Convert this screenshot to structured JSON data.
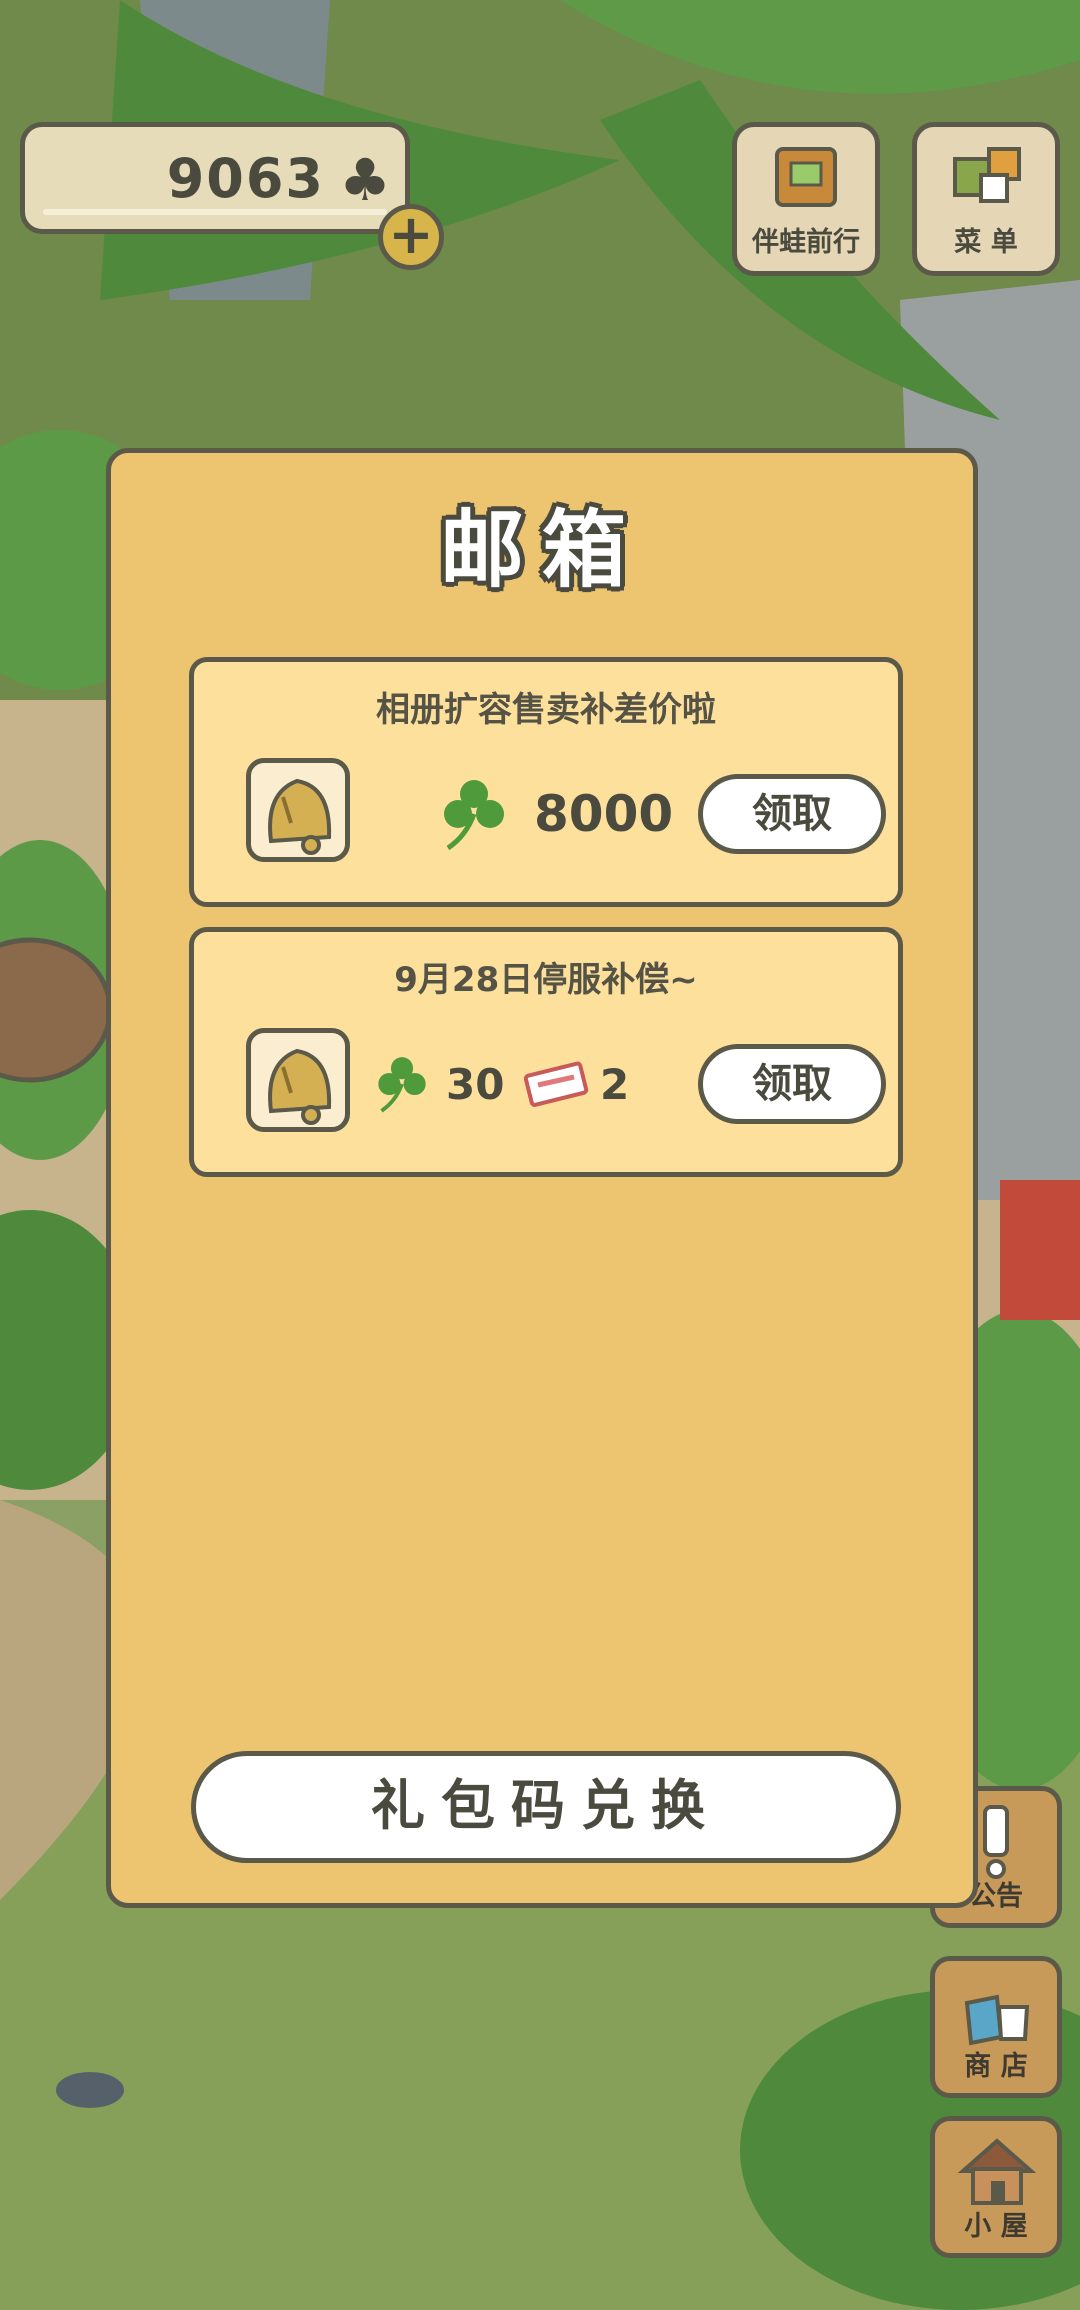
{
  "hud": {
    "clover_count": "9063",
    "buttons": {
      "travel_label": "伴蛙前行",
      "menu_label": "菜 单",
      "notice_label": "公告",
      "shop_label": "商 店",
      "house_label": "小 屋"
    }
  },
  "mailbox": {
    "title": "邮箱",
    "mails": [
      {
        "subject": "相册扩容售卖补差价啦",
        "clover": "8000",
        "claim_label": "领取"
      },
      {
        "subject": "9月28日停服补偿~",
        "clover": "30",
        "ticket": "2",
        "claim_label": "领取"
      }
    ],
    "redeem_label": "礼包码兑换"
  },
  "colors": {
    "panel": "#edc470",
    "card": "#fde09b",
    "outline": "#5b5a4a",
    "clover": "#4f9a3a"
  }
}
